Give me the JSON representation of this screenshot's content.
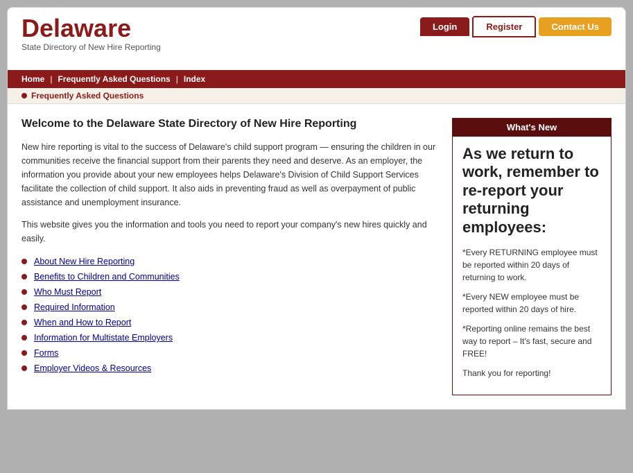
{
  "header": {
    "logo_main": "Delaware",
    "logo_sub": "State Directory of New Hire Reporting",
    "btn_login": "Login",
    "btn_register": "Register",
    "btn_contact": "Contact Us"
  },
  "navbar": {
    "items": [
      {
        "label": "Home"
      },
      {
        "label": "Frequently Asked Questions"
      },
      {
        "label": "Index"
      }
    ]
  },
  "faq_bar": {
    "link": "Frequently Asked Questions"
  },
  "main": {
    "page_title": "Welcome to the Delaware State Directory of New Hire Reporting",
    "intro_text": "New hire reporting is vital to the success of Delaware's child support program — ensuring the children in our communities receive the financial support from their parents they need and deserve. As an employer, the information you provide about your new employees helps Delaware's Division of Child Support Services facilitate the collection of child support. It also aids in preventing fraud as well as overpayment of public assistance and unemployment insurance.",
    "tools_text": "This website gives you the information and tools you need to report your company's new hires quickly and easily.",
    "links": [
      "About New Hire Reporting",
      "Benefits to Children and Communities",
      "Who Must Report",
      "Required Information",
      "When and How to Report",
      "Information for Multistate Employers",
      "Forms",
      "Employer Videos & Resources"
    ]
  },
  "sidebar": {
    "header": "What's New",
    "headline": "As we return to work, remember to re-report your returning employees:",
    "paragraphs": [
      "*Every RETURNING employee must be reported within 20 days of returning to work.",
      "*Every NEW employee must be reported within 20 days of hire.",
      "*Reporting online remains the best way to report – It's fast, secure and FREE!",
      "Thank you for reporting!"
    ]
  }
}
